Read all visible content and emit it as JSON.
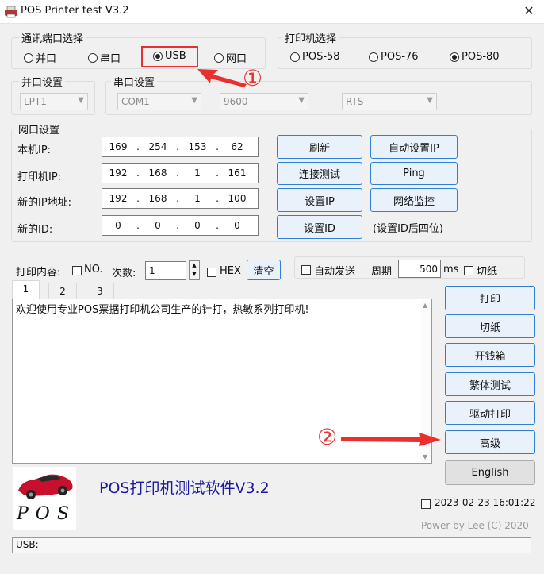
{
  "window": {
    "title": "POS Printer test V3.2",
    "close_glyph": "✕",
    "icon": "printer-app-icon"
  },
  "port_select": {
    "label": "通讯端口选择",
    "options": [
      {
        "label": "并口",
        "selected": false
      },
      {
        "label": "串口",
        "selected": false
      },
      {
        "label": "USB",
        "selected": true
      },
      {
        "label": "网口",
        "selected": false
      }
    ]
  },
  "printer_select": {
    "label": "打印机选择",
    "options": [
      {
        "label": "POS-58",
        "selected": false
      },
      {
        "label": "POS-76",
        "selected": false
      },
      {
        "label": "POS-80",
        "selected": true
      }
    ]
  },
  "parallel": {
    "label": "并口设置",
    "port": "LPT1"
  },
  "serial": {
    "label": "串口设置",
    "port": "COM1",
    "baud": "9600",
    "flow": "RTS"
  },
  "network": {
    "label": "网口设置",
    "rows": [
      {
        "label": "本机IP:",
        "ip": [
          "169",
          "254",
          "153",
          "62"
        ]
      },
      {
        "label": "打印机IP:",
        "ip": [
          "192",
          "168",
          "1",
          "161"
        ]
      },
      {
        "label": "新的IP地址:",
        "ip": [
          "192",
          "168",
          "1",
          "100"
        ]
      },
      {
        "label": "新的ID:",
        "ip": [
          "0",
          "0",
          "0",
          "0"
        ]
      }
    ],
    "btn_refresh": "刷新",
    "btn_auto_ip": "自动设置IP",
    "btn_conn_test": "连接测试",
    "btn_ping": "Ping",
    "btn_set_ip": "设置IP",
    "btn_monitor": "网络监控",
    "btn_set_id": "设置ID",
    "id_note": "(设置ID后四位)"
  },
  "print_opts": {
    "content_label": "打印内容:",
    "no_label": "NO.",
    "count_label": "次数:",
    "count_value": "1",
    "hex_label": "HEX",
    "clear_btn": "清空",
    "auto_send_label": "自动发送",
    "period_label": "周期",
    "period_value": "500",
    "ms_label": "ms",
    "cut_label": "切纸"
  },
  "tabs": [
    "1",
    "2",
    "3"
  ],
  "print_text": "欢迎使用专业POS票据打印机公司生产的针打，热敏系列打印机!",
  "side_buttons": [
    "打印",
    "切纸",
    "开钱箱",
    "繁体测试",
    "驱动打印",
    "高级",
    "English"
  ],
  "brand_title": "POS打印机测试软件V3.2",
  "logo_text": "P O S",
  "datetime": "2023-02-23 16:01:22",
  "power_by": "Power by Lee (C) 2020",
  "status": "USB:",
  "annotations": {
    "mark1": "①",
    "mark2": "②"
  },
  "colors": {
    "annotation_red": "#e8312f",
    "button_border": "#2f7fd6",
    "brand_blue": "#1a1a9a"
  }
}
